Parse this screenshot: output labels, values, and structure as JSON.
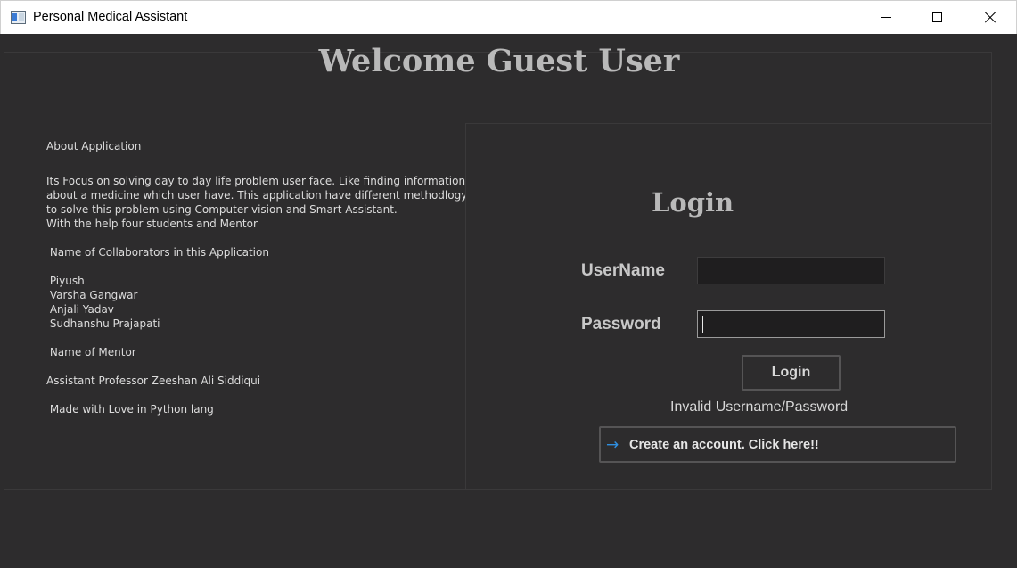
{
  "window": {
    "title": "Personal Medical Assistant",
    "icon": "app-window-icon"
  },
  "header": {
    "title": "Welcome Guest User"
  },
  "about": {
    "heading": "About Application",
    "description_lines": [
      "Its Focus on solving day to day life problem user face. Like finding information",
      "about a medicine which user have. This application have different methodlogy",
      "to solve this problem using Computer vision and Smart Assistant.",
      "With the help four students and Mentor"
    ],
    "collaborators_heading": " Name of Collaborators in this Application",
    "collaborators": [
      " Piyush",
      " Varsha Gangwar",
      " Anjali Yadav",
      " Sudhanshu Prajapati"
    ],
    "mentor_heading": " Name of Mentor",
    "mentor": "Assistant Professor Zeeshan Ali Siddiqui",
    "footer": " Made with Love in Python lang"
  },
  "login": {
    "heading": "Login",
    "username_label": "UserName",
    "username_value": "",
    "password_label": "Password",
    "password_value": "",
    "button_label": "Login",
    "status": "Invalid Username/Password",
    "create_account_label": "Create an account. Click here!!",
    "create_account_icon": "arrow-right-icon"
  },
  "colors": {
    "background": "#2d2c2d",
    "text": "#dcdcdc",
    "heading": "#b9b9b9",
    "link_arrow": "#2f8fe0"
  }
}
